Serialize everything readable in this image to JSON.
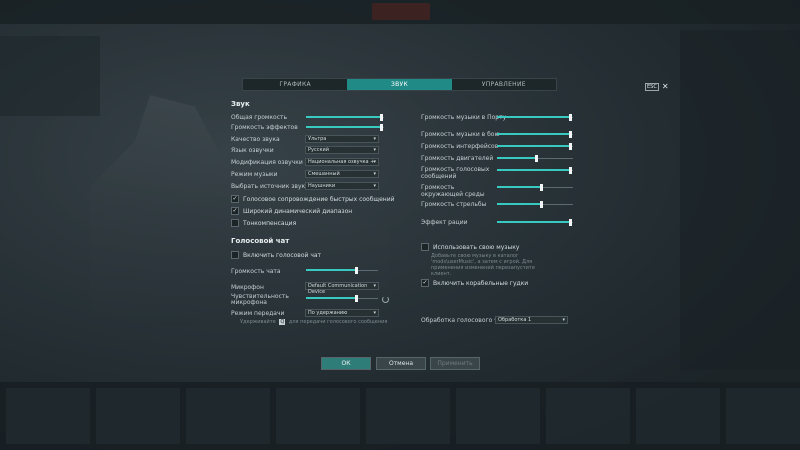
{
  "tabs": [
    "ГРАФИКА",
    "ЗВУК",
    "УПРАВЛЕНИЕ"
  ],
  "active_tab": 1,
  "close": {
    "key_label": "ESC",
    "icon": "close-icon"
  },
  "sound": {
    "title": "Звук",
    "left_sliders": [
      {
        "label": "Общая громкость",
        "value": 0.97
      },
      {
        "label": "Громкость эффектов",
        "value": 0.97
      }
    ],
    "selects": [
      {
        "label": "Качество звука",
        "value": "Ультра"
      },
      {
        "label": "Язык озвучки",
        "value": "Русский"
      },
      {
        "label": "Модификация озвучки",
        "value": "Национальная озвучка +"
      },
      {
        "label": "Режим музыки",
        "value": "Смешанный"
      },
      {
        "label": "Выбрать источник звука",
        "value": "Наушники"
      }
    ],
    "checks": [
      {
        "label": "Голосовое сопровождение быстрых сообщений",
        "checked": true
      },
      {
        "label": "Широкий динамический диапазон",
        "checked": true
      },
      {
        "label": "Тонкомпенсация",
        "checked": false
      }
    ],
    "right_sliders": [
      {
        "label": "Громкость музыки в Порту",
        "value": 0.97
      },
      {
        "label": "Громкость музыки в бою",
        "value": 0.97
      },
      {
        "label": "Громкость интерфейсов",
        "value": 0.97
      },
      {
        "label": "Громкость двигателей",
        "value": 0.52
      },
      {
        "label": "Громкость голосовых сообщений",
        "value": 0.97
      },
      {
        "label": "Громкость окружающей среды",
        "value": 0.58
      },
      {
        "label": "Громкость стрельбы",
        "value": 0.58
      },
      {
        "label": "Эффект рации",
        "value": 0.97
      }
    ],
    "own_music": {
      "label": "Использовать свою музыку",
      "checked": false,
      "hint": "Добавьте свою музыку в каталог 'mods\\userMusic', а затем с игрой. Для применения изменений перезапустите клиент."
    },
    "ship_horns": {
      "label": "Включить корабельные гудки",
      "checked": true
    }
  },
  "voice": {
    "title": "Голосовой чат",
    "enable": {
      "label": "Включить голосовой чат",
      "checked": false
    },
    "chat_volume": {
      "label": "Громкость чата",
      "value": 0.7
    },
    "mic": {
      "label": "Микрофон",
      "value": "Default Communication Device"
    },
    "sensitivity": {
      "label": "Чувствительность микрофона",
      "value": 0.7
    },
    "mode": {
      "label": "Режим передачи",
      "value": "По удержанию"
    },
    "hold_hint_pre": "Удерживайте",
    "hold_key": "Q",
    "hold_hint_post": "для передачи голосового сообщения",
    "processing": {
      "label": "Обработка голосового чата",
      "value": "Обработка 1"
    }
  },
  "buttons": {
    "ok": "ОК",
    "cancel": "Отмена",
    "apply": "Применить"
  },
  "colors": {
    "accent": "#38c9c1",
    "tab_active": "#1f8a86"
  }
}
